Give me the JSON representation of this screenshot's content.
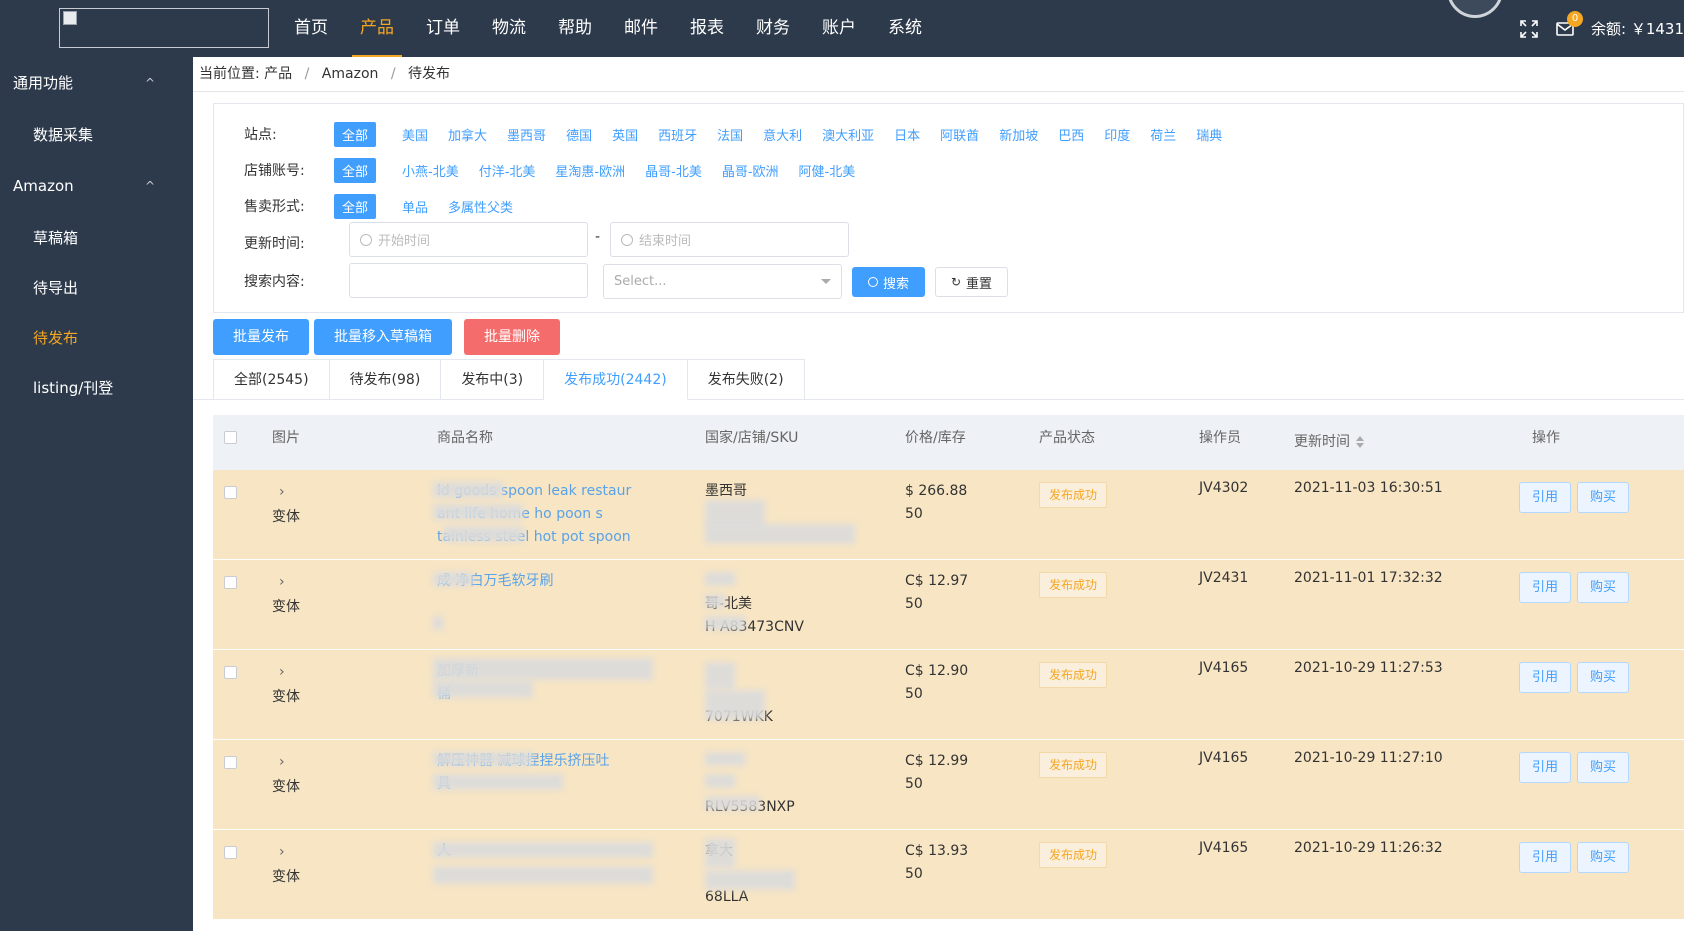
{
  "header": {
    "nav": [
      "首页",
      "产品",
      "订单",
      "物流",
      "帮助",
      "邮件",
      "报表",
      "财务",
      "账户",
      "系统"
    ],
    "active_nav": "产品",
    "mail_badge": "0",
    "balance": "余额: ￥1431"
  },
  "sidebar": {
    "groups": [
      {
        "label": "通用功能",
        "items": [
          "数据采集"
        ]
      },
      {
        "label": "Amazon",
        "items": [
          "草稿箱",
          "待导出",
          "待发布",
          "listing/刊登"
        ]
      }
    ],
    "active_item": "待发布"
  },
  "breadcrumb": {
    "prefix": "当前位置:",
    "items": [
      "产品",
      "Amazon",
      "待发布"
    ],
    "sep": "/"
  },
  "filters": {
    "site": {
      "label": "站点:",
      "options": [
        "全部",
        "美国",
        "加拿大",
        "墨西哥",
        "德国",
        "英国",
        "西班牙",
        "法国",
        "意大利",
        "澳大利亚",
        "日本",
        "阿联酋",
        "新加坡",
        "巴西",
        "印度",
        "荷兰",
        "瑞典"
      ]
    },
    "store": {
      "label": "店铺账号:",
      "options": [
        "全部",
        "小燕-北美",
        "付洋-北美",
        "星淘惠-欧洲",
        "晶哥-北美",
        "晶哥-欧洲",
        "阿健-北美"
      ]
    },
    "sale_type": {
      "label": "售卖形式:",
      "options": [
        "全部",
        "单品",
        "多属性父类"
      ]
    },
    "update_time": {
      "label": "更新时间:",
      "start_placeholder": "开始时间",
      "end_placeholder": "结束时间",
      "dash": "-"
    },
    "search": {
      "label": "搜索内容:",
      "value": "",
      "select_placeholder": "Select...",
      "search_btn": "搜索",
      "reset_btn": "重置"
    }
  },
  "bulk_actions": {
    "publish": "批量发布",
    "move_to_draft": "批量移入草稿箱",
    "delete": "批量删除"
  },
  "tabs": [
    "全部(2545)",
    "待发布(98)",
    "发布中(3)",
    "发布成功(2442)",
    "发布失败(2)"
  ],
  "active_tab": "发布成功(2442)",
  "table": {
    "columns": {
      "image": "图片",
      "name": "商品名称",
      "country_store_sku": "国家/店铺/SKU",
      "price_stock": "价格/库存",
      "status": "产品状态",
      "operator": "操作员",
      "update_time": "更新时间",
      "actions": "操作"
    },
    "variant_label": "变体",
    "action_labels": {
      "cite": "引用",
      "buy": "购买"
    },
    "rows": [
      {
        "name": [
          "ld goods spoon leak restaur",
          "ant life home ho          poon s",
          "tainless steel hot pot spoon"
        ],
        "country_store_sku": [
          "墨西哥",
          "",
          ""
        ],
        "price": "$ 266.88",
        "stock": "50",
        "status": "发布成功",
        "operator": "JV4302",
        "updated": "2021-11-03 16:30:51"
      },
      {
        "name": [
          "成          净白万毛软牙刷"
        ],
        "country_store_sku": [
          "",
          "哥-北美",
          "H        A83473CNV"
        ],
        "price": "C$ 12.97",
        "stock": "50",
        "status": "发布成功",
        "operator": "JV2431",
        "updated": "2021-11-01 17:32:32"
      },
      {
        "name": [
          "加厚新",
          "       桶"
        ],
        "country_store_sku": [
          "",
          "",
          "      7071WKK"
        ],
        "price": "C$ 12.90",
        "stock": "50",
        "status": "发布成功",
        "operator": "JV4165",
        "updated": "2021-10-29 11:27:53"
      },
      {
        "name": [
          "解压神器           减球捏捏乐挤压吐",
          "           具"
        ],
        "country_store_sku": [
          "",
          "",
          "     RLV5583NXP"
        ],
        "price": "C$ 12.99",
        "stock": "50",
        "status": "发布成功",
        "operator": "JV4165",
        "updated": "2021-10-29 11:27:10"
      },
      {
        "name": [
          "                   人",
          ""
        ],
        "country_store_sku": [
          "拿大",
          "",
          "      68LLA"
        ],
        "price": "C$ 13.93",
        "stock": "50",
        "status": "发布成功",
        "operator": "JV4165",
        "updated": "2021-10-29 11:26:32"
      }
    ]
  },
  "colors": {
    "topbar": "#2d3a4b",
    "accent": "#f5a623",
    "primary": "#409eff",
    "danger": "#f56c6c",
    "row_highlight": "#f7e5c4"
  }
}
